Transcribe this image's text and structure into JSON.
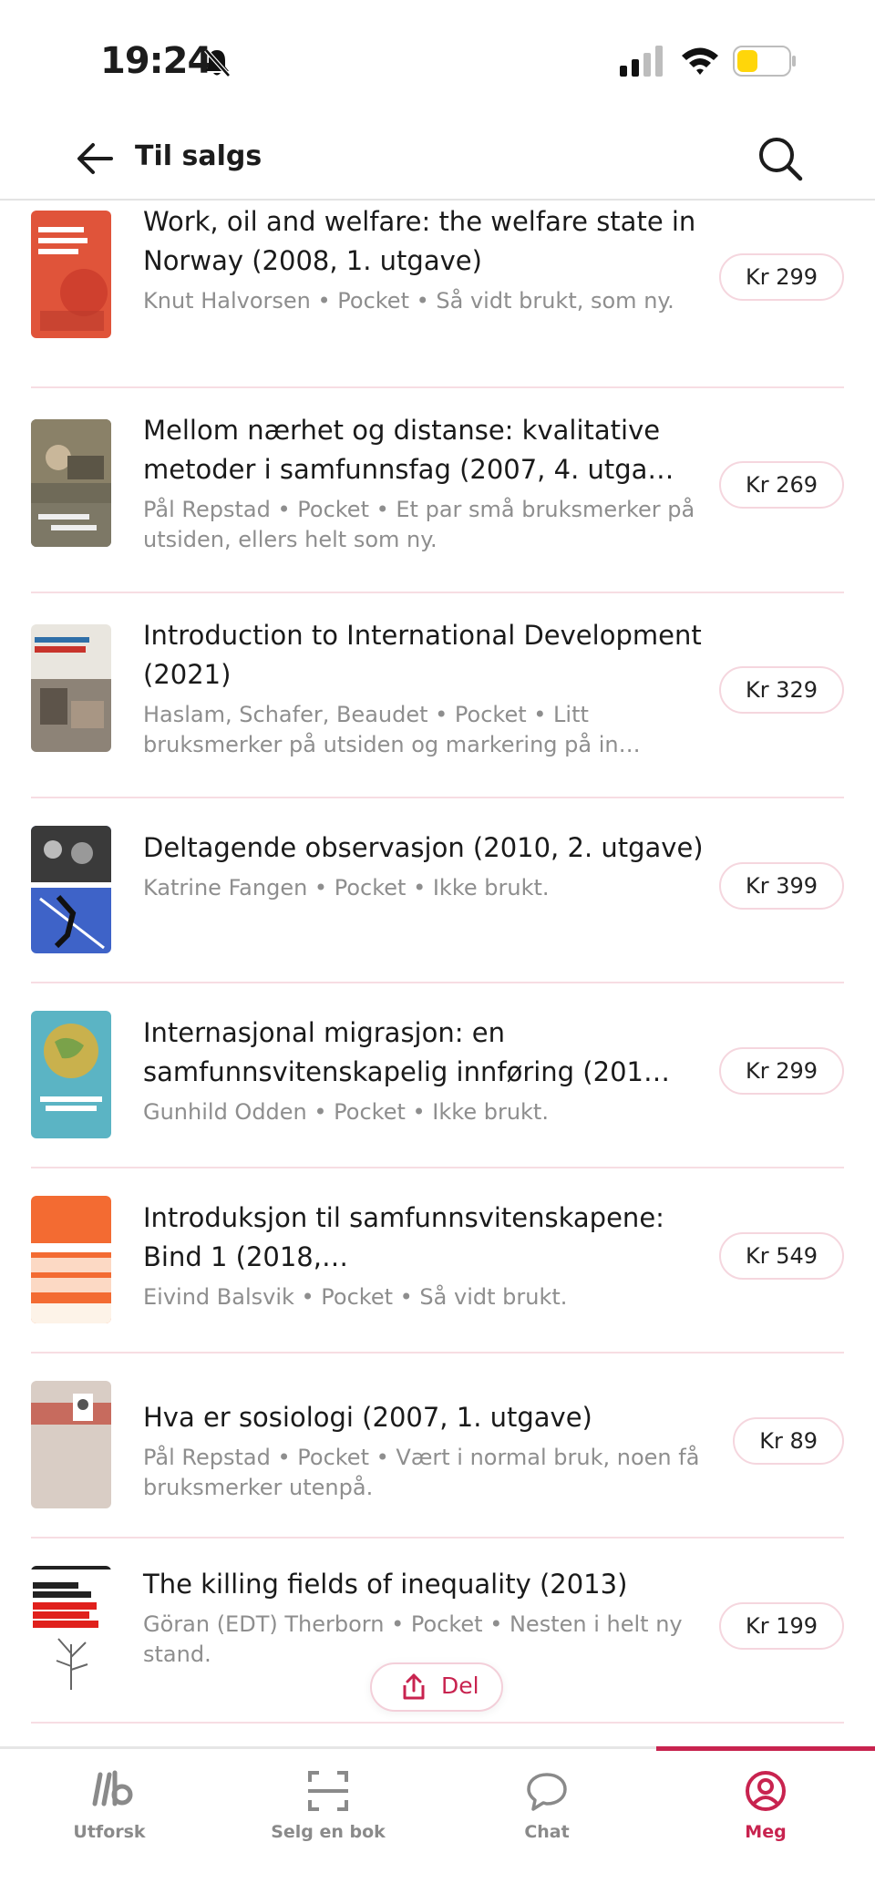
{
  "status": {
    "time": "19:24"
  },
  "header": {
    "title": "Til salgs"
  },
  "books": [
    {
      "title": "Work, oil and welfare: the welfare state in Norway (2008, 1. utgave)",
      "meta": "Knut Halvorsen • Pocket • Så vidt brukt, som ny.",
      "price": "Kr 299",
      "cover_color": "#e0543a"
    },
    {
      "title": "Mellom nærhet og distanse: kvalitative metoder i samfunnsfag (2007, 4. utga…",
      "meta": "Pål Repstad • Pocket • Et par små bruksmerker på utsiden, ellers helt som ny.",
      "price": "Kr 269",
      "cover_color": "#6f6a58"
    },
    {
      "title": "Introduction to International Development (2021)",
      "meta": "Haslam, Schafer, Beaudet • Pocket • Litt bruksmerker på utsiden og markering på in…",
      "price": "Kr 329",
      "cover_color": "#e9e6df"
    },
    {
      "title": "Deltagende observasjon (2010, 2. utgave)",
      "meta": "Katrine Fangen • Pocket • Ikke brukt.",
      "price": "Kr 399",
      "cover_color": "#3e63c8"
    },
    {
      "title": "Internasjonal migrasjon: en samfunnsvitenskapelig innføring (201…",
      "meta": "Gunhild Odden • Pocket • Ikke brukt.",
      "price": "Kr 299",
      "cover_color": "#5bb4c4"
    },
    {
      "title": "Introduksjon til samfunnsvitenskapene: Bind 1 (2018,…",
      "meta": "Eivind Balsvik • Pocket • Så vidt brukt.",
      "price": "Kr 549",
      "cover_color": "#f36b32"
    },
    {
      "title": "Hva er sosiologi (2007, 1. utgave)",
      "meta": "Pål Repstad • Pocket • Vært i normal bruk, noen få bruksmerker utenpå.",
      "price": "Kr 89",
      "cover_color": "#d9cdc5"
    },
    {
      "title": "The killing fields of inequality (2013)",
      "meta": "Göran (EDT) Therborn • Pocket • Nesten i helt ny stand.",
      "price": "Kr 199",
      "cover_color": "#ffffff"
    }
  ],
  "share": {
    "label": "Del"
  },
  "tabs": [
    {
      "label": "Utforsk"
    },
    {
      "label": "Selg en bok"
    },
    {
      "label": "Chat"
    },
    {
      "label": "Meg"
    }
  ],
  "colors": {
    "accent": "#c8234f",
    "divider": "#f7dde3"
  }
}
